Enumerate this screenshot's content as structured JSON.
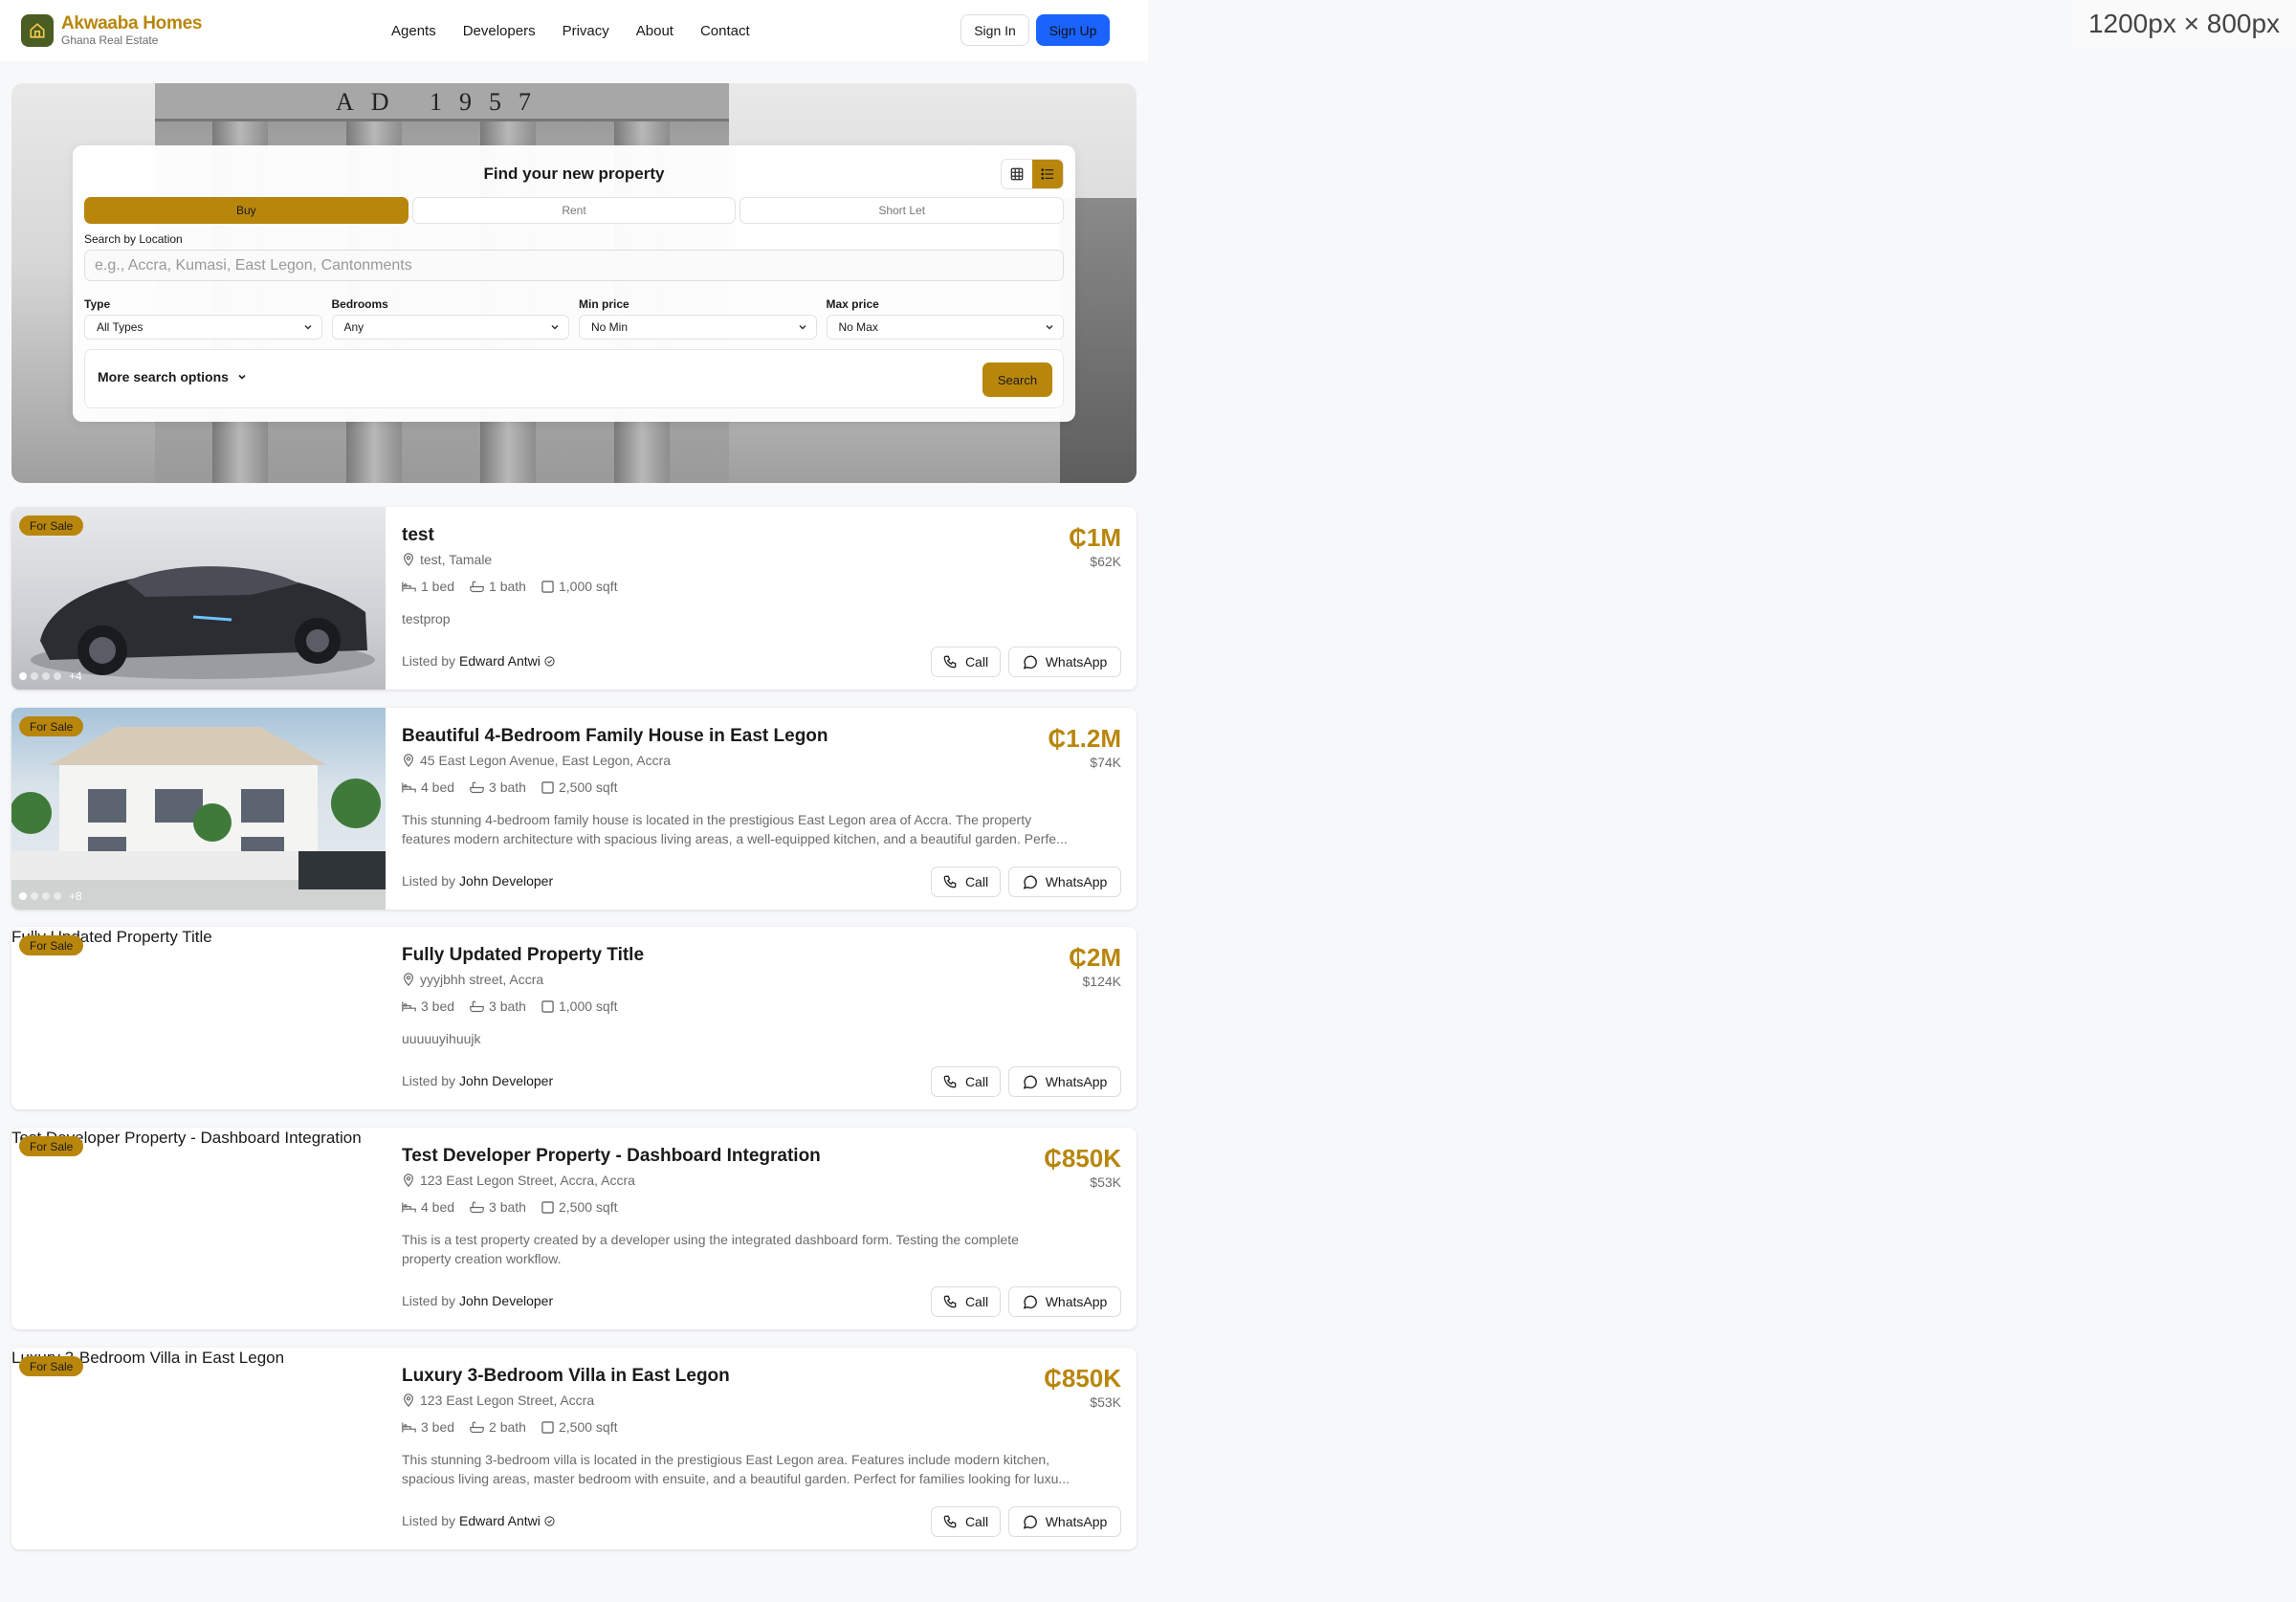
{
  "brand": {
    "name": "Akwaaba Homes",
    "subtitle": "Ghana Real Estate"
  },
  "nav": [
    "Agents",
    "Developers",
    "Privacy",
    "About",
    "Contact"
  ],
  "auth": {
    "signin": "Sign In",
    "signup": "Sign Up"
  },
  "viewport_tag": "1200px × 800px",
  "hero": {
    "monument_text": "AD 1957"
  },
  "search": {
    "title": "Find your new property",
    "tabs": [
      "Buy",
      "Rent",
      "Short Let"
    ],
    "active_tab": "Buy",
    "location_label": "Search by Location",
    "location_placeholder": "e.g., Accra, Kumasi, East Legon, Cantonments",
    "filters": [
      {
        "label": "Type",
        "value": "All Types"
      },
      {
        "label": "Bedrooms",
        "value": "Any"
      },
      {
        "label": "Min price",
        "value": "No Min"
      },
      {
        "label": "Max price",
        "value": "No Max"
      }
    ],
    "more_options": "More search options",
    "search_button": "Search"
  },
  "listings": [
    {
      "badge": "For Sale",
      "title": "test",
      "price": "₵1M",
      "price_usd": "$62K",
      "address": "test, Tamale",
      "beds": "1 bed",
      "baths": "1 bath",
      "area": "1,000 sqft",
      "description_line1": "testprop",
      "description_line2": "",
      "listed_prefix": "Listed by",
      "agent": "Edward Antwi",
      "image_count": "+4",
      "image_alt": "",
      "call": "Call",
      "whatsapp": "WhatsApp"
    },
    {
      "badge": "For Sale",
      "title": "Beautiful 4-Bedroom Family House in East Legon",
      "price": "₵1.2M",
      "price_usd": "$74K",
      "address": "45 East Legon Avenue, East Legon, Accra",
      "beds": "4 bed",
      "baths": "3 bath",
      "area": "2,500 sqft",
      "description_line1": "This stunning 4-bedroom family house is located in the prestigious East Legon area of Accra. The property",
      "description_line2": "features modern architecture with spacious living areas, a well-equipped kitchen, and a beautiful garden. Perfe...",
      "listed_prefix": "Listed by",
      "agent": "John Developer",
      "image_count": "+8",
      "image_alt": "",
      "call": "Call",
      "whatsapp": "WhatsApp"
    },
    {
      "badge": "For Sale",
      "title": "Fully Updated Property Title",
      "price": "₵2M",
      "price_usd": "$124K",
      "address": "yyyjbhh street, Accra",
      "beds": "3 bed",
      "baths": "3 bath",
      "area": "1,000 sqft",
      "description_line1": "uuuuuyihuujk",
      "description_line2": "",
      "listed_prefix": "Listed by",
      "agent": "John Developer",
      "image_count": "",
      "image_alt": "Fully Updated Property Title",
      "call": "Call",
      "whatsapp": "WhatsApp"
    },
    {
      "badge": "For Sale",
      "title": "Test Developer Property - Dashboard Integration",
      "price": "₵850K",
      "price_usd": "$53K",
      "address": "123 East Legon Street, Accra, Accra",
      "beds": "4 bed",
      "baths": "3 bath",
      "area": "2,500 sqft",
      "description_line1": "This is a test property created by a developer using the integrated dashboard form. Testing the complete",
      "description_line2": "property creation workflow.",
      "listed_prefix": "Listed by",
      "agent": "John Developer",
      "image_count": "",
      "image_alt": "Test Developer Property - Dashboard Integration",
      "call": "Call",
      "whatsapp": "WhatsApp"
    },
    {
      "badge": "For Sale",
      "title": "Luxury 3-Bedroom Villa in East Legon",
      "price": "₵850K",
      "price_usd": "$53K",
      "address": "123 East Legon Street, Accra",
      "beds": "3 bed",
      "baths": "2 bath",
      "area": "2,500 sqft",
      "description_line1": "This stunning 3-bedroom villa is located in the prestigious East Legon area. Features include modern kitchen,",
      "description_line2": "spacious living areas, master bedroom with ensuite, and a beautiful garden. Perfect for families looking for luxu...",
      "listed_prefix": "Listed by",
      "agent": "Edward Antwi",
      "image_count": "",
      "image_alt": "Luxury 3-Bedroom Villa in East Legon",
      "call": "Call",
      "whatsapp": "WhatsApp"
    }
  ],
  "colors": {
    "accent": "#b8860b",
    "primary_blue": "#1a63ff",
    "logo_bg": "#4a5d23"
  }
}
